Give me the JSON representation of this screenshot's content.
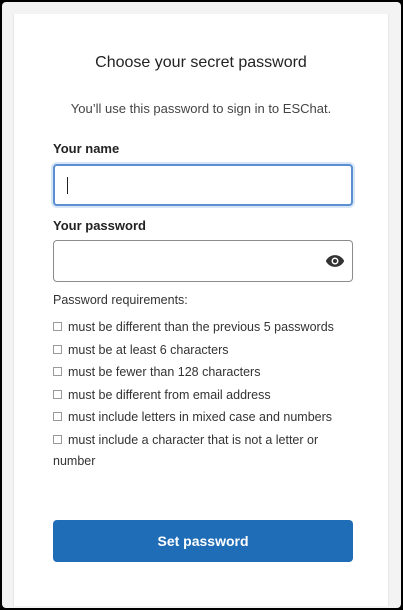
{
  "title": "Choose your secret password",
  "subtitle": "You’ll use this password to sign in to ESChat.",
  "fields": {
    "name_label": "Your name",
    "name_value": "",
    "password_label": "Your password",
    "password_value": ""
  },
  "requirements": {
    "heading": "Password requirements:",
    "items": [
      "must be different than the previous 5 passwords",
      "must be at least 6 characters",
      "must be fewer than 128 characters",
      "must be different from email address",
      "must include letters in mixed case and numbers",
      "must include a character that is not a letter or number"
    ]
  },
  "submit_label": "Set password",
  "icons": {
    "show_password": "eye-icon",
    "requirement_checkbox": "checkbox-icon"
  },
  "colors": {
    "accent": "#1f6cb7",
    "focus_border": "#5b8fd1"
  }
}
